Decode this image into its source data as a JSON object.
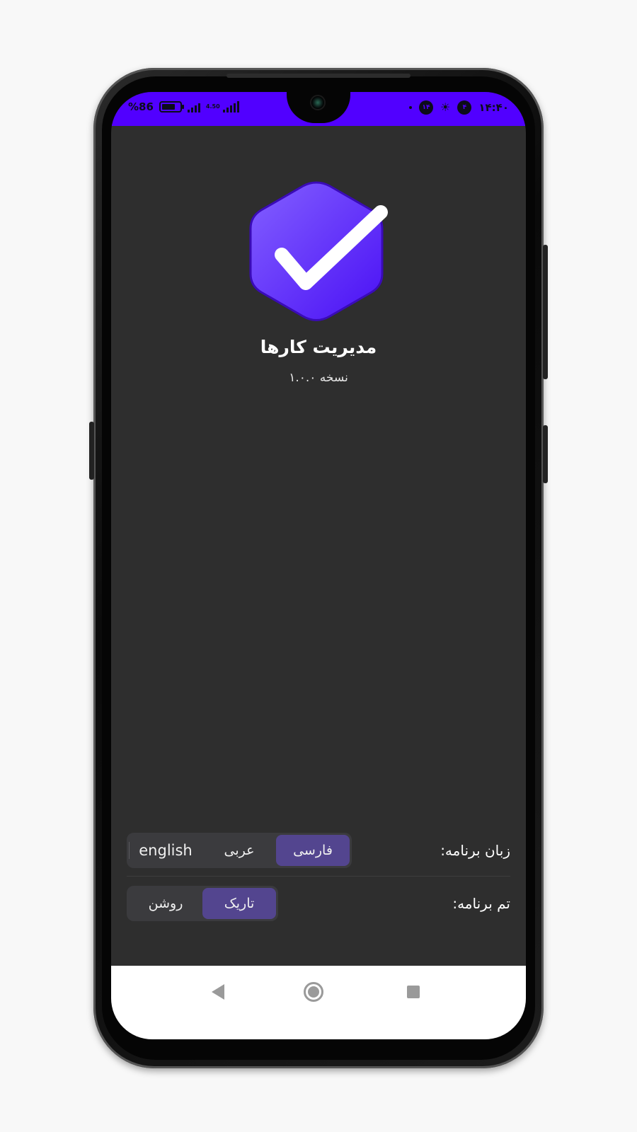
{
  "status_bar": {
    "battery_text": "%86",
    "net_speed": "4.50",
    "time": "۱۴:۴۰",
    "notification_badge_1": "۱۴",
    "notification_badge_2": "۴"
  },
  "app": {
    "title": "مدیریت کارها",
    "version": "نسخه ۱.۰.۰"
  },
  "settings": {
    "language": {
      "label": "زبان برنامه:",
      "options": [
        "فارسی",
        "عربی",
        "english"
      ],
      "selected": "فارسی"
    },
    "theme": {
      "label": "تم برنامه:",
      "options": [
        "تاریک",
        "روشن"
      ],
      "selected": "تاریک"
    }
  },
  "colors": {
    "status_bar": "#5100ff",
    "screen_bg": "#2e2e2e",
    "accent_active": "#53458f",
    "logo_gradient_start": "#7b55ff",
    "logo_gradient_end": "#4a10f5"
  }
}
